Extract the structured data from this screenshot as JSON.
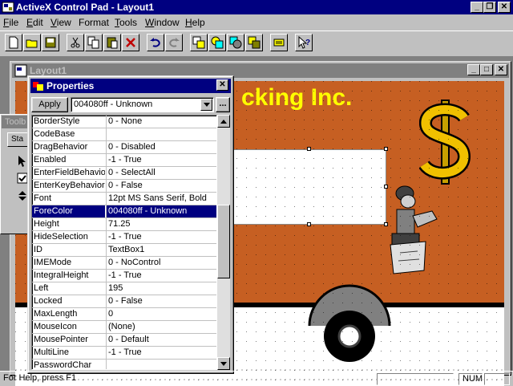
{
  "app": {
    "title": "ActiveX Control Pad - Layout1"
  },
  "menu": {
    "items": [
      {
        "label": "File",
        "underline": "F",
        "rest": "ile"
      },
      {
        "label": "Edit",
        "underline": "E",
        "rest": "dit"
      },
      {
        "label": "View",
        "underline": "V",
        "rest": "iew"
      },
      {
        "label": "Format",
        "underline": "",
        "rest": "Format"
      },
      {
        "label": "Tools",
        "underline": "T",
        "rest": "ools"
      },
      {
        "label": "Window",
        "underline": "W",
        "rest": "indow"
      },
      {
        "label": "Help",
        "underline": "H",
        "rest": "elp"
      }
    ]
  },
  "toolbar": {
    "icons": [
      "new-file-icon",
      "open-folder-icon",
      "save-disk-icon",
      "cut-scissors-icon",
      "copy-icon",
      "paste-icon",
      "delete-x-icon",
      "undo-icon",
      "redo-icon",
      "bring-to-front-icon",
      "send-to-back-icon",
      "bring-forward-icon",
      "send-backward-icon",
      "snap-to-grid-icon",
      "context-help-icon"
    ]
  },
  "layout_window": {
    "title": "Layout1",
    "banner_text": "cking Inc."
  },
  "toolbox": {
    "title": "Toolb",
    "tab_label": "Sta"
  },
  "properties": {
    "title": "Properties",
    "apply_label": "Apply",
    "current_value": "004080ff - Unknown",
    "ellipsis_label": "...",
    "rows": [
      {
        "name": "BorderStyle",
        "value": "0 - None"
      },
      {
        "name": "CodeBase",
        "value": ""
      },
      {
        "name": "DragBehavior",
        "value": "0 - Disabled"
      },
      {
        "name": "Enabled",
        "value": "-1 - True"
      },
      {
        "name": "EnterFieldBehavior",
        "value": "0 - SelectAll"
      },
      {
        "name": "EnterKeyBehavior",
        "value": "0 - False"
      },
      {
        "name": "Font",
        "value": "12pt MS Sans Serif, Bold"
      },
      {
        "name": "ForeColor",
        "value": "004080ff - Unknown"
      },
      {
        "name": "Height",
        "value": "71.25"
      },
      {
        "name": "HideSelection",
        "value": "-1 - True"
      },
      {
        "name": "ID",
        "value": "TextBox1"
      },
      {
        "name": "IMEMode",
        "value": "0 - NoControl"
      },
      {
        "name": "IntegralHeight",
        "value": "-1 - True"
      },
      {
        "name": "Left",
        "value": "195"
      },
      {
        "name": "Locked",
        "value": "0 - False"
      },
      {
        "name": "MaxLength",
        "value": "0"
      },
      {
        "name": "MouseIcon",
        "value": "(None)"
      },
      {
        "name": "MousePointer",
        "value": "0 - Default"
      },
      {
        "name": "MultiLine",
        "value": "-1 - True"
      },
      {
        "name": "PasswordChar",
        "value": ""
      }
    ],
    "selected_index": 7
  },
  "statusbar": {
    "help_text": "For Help, press F1",
    "num_label": "NUM"
  },
  "colors": {
    "title_active": "#000080",
    "title_inactive": "#808080",
    "face": "#c0c0c0",
    "truck_orange": "#c65f22",
    "banner_yellow": "#ffff00"
  }
}
